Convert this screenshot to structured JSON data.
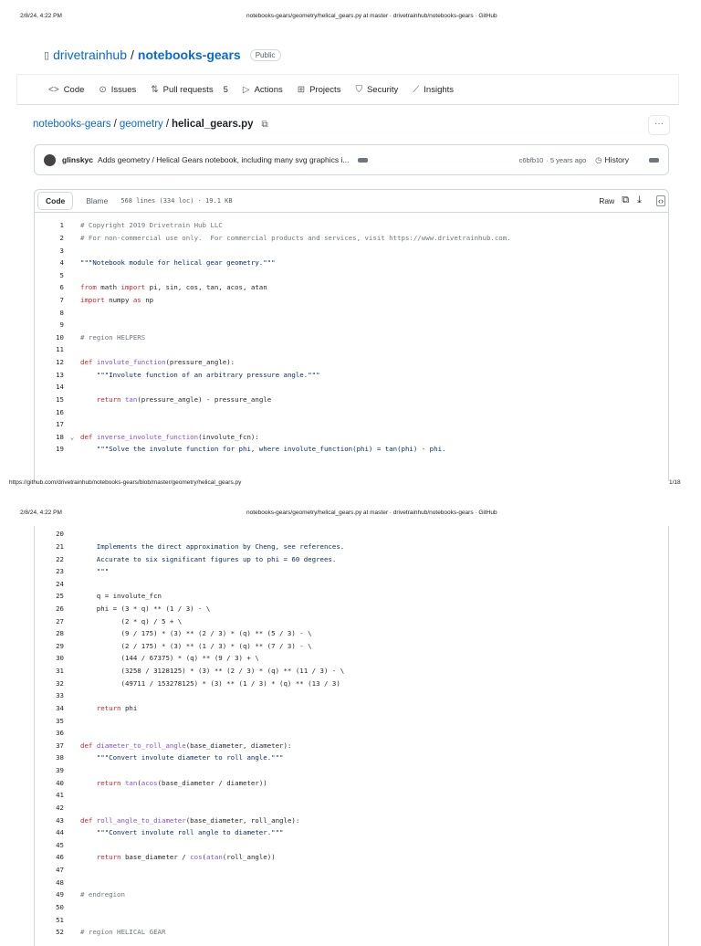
{
  "print_header": {
    "datetime": "2/8/24, 4:22 PM",
    "title": "notebooks-gears/geometry/helical_gears.py at master · drivetrainhub/notebooks-gears · GitHub"
  },
  "print_footer": {
    "url": "https://github.com/drivetrainhub/notebooks-gears/blob/master/geometry/helical_gears.py",
    "page": "1/18"
  },
  "repo": {
    "owner": "drivetrainhub",
    "separator": "/",
    "name": "notebooks-gears",
    "visibility": "Public"
  },
  "nav": [
    {
      "label": "Code",
      "icon": "code-icon",
      "glyph": "<>"
    },
    {
      "label": "Issues",
      "icon": "issue-icon",
      "glyph": "⊙"
    },
    {
      "label": "Pull requests",
      "icon": "pull-request-icon",
      "glyph": "⇅",
      "count": "5"
    },
    {
      "label": "Actions",
      "icon": "play-icon",
      "glyph": "▷"
    },
    {
      "label": "Projects",
      "icon": "table-icon",
      "glyph": "⊞"
    },
    {
      "label": "Security",
      "icon": "shield-icon",
      "glyph": "⛉"
    },
    {
      "label": "Insights",
      "icon": "graph-icon",
      "glyph": "⟋"
    }
  ],
  "breadcrumb": {
    "repo": "notebooks-gears",
    "folder": "geometry",
    "file": "helical_gears.py",
    "sep": "/"
  },
  "commit": {
    "author": "glinskyc",
    "message": "Adds geometry / Helical Gears notebook, including many svg graphics i...",
    "sha": "c6bfb10",
    "age": "· 5 years ago",
    "history": "History"
  },
  "file": {
    "tab_code": "Code",
    "tab_blame": "Blame",
    "info": "568 lines (334 loc) · 19.1 KB",
    "raw": "Raw"
  },
  "code_pages": [
    {
      "start": 1,
      "lines": [
        [
          [
            "c",
            "# Copyright 2019 Drivetrain Hub LLC"
          ]
        ],
        [
          [
            "c",
            "# For non-commercial use only.  For commercial products and services, visit https://www.drivetrainhub.com."
          ]
        ],
        [],
        [
          [
            "s",
            "\"\"\"Notebook module for helical gear geometry.\"\"\""
          ]
        ],
        [],
        [
          [
            "k",
            "from"
          ],
          [
            "n",
            " math "
          ],
          [
            "k",
            "import"
          ],
          [
            "n",
            " pi, sin, cos, tan, acos, atan"
          ]
        ],
        [
          [
            "k",
            "import"
          ],
          [
            "n",
            " numpy "
          ],
          [
            "k",
            "as"
          ],
          [
            "n",
            " np"
          ]
        ],
        [],
        [],
        [
          [
            "c",
            "# region HELPERS"
          ]
        ],
        [],
        [
          [
            "k",
            "def"
          ],
          [
            "n",
            " "
          ],
          [
            "f",
            "involute_function"
          ],
          [
            "n",
            "(pressure_angle):"
          ]
        ],
        [
          [
            "n",
            "    "
          ],
          [
            "s",
            "\"\"\"Involute function of an arbitrary pressure angle.\"\"\""
          ]
        ],
        [],
        [
          [
            "n",
            "    "
          ],
          [
            "k",
            "return"
          ],
          [
            "n",
            " "
          ],
          [
            "f",
            "tan"
          ],
          [
            "n",
            "(pressure_angle) - pressure_angle"
          ]
        ],
        [],
        [],
        [
          [
            "k",
            "def"
          ],
          [
            "n",
            " "
          ],
          [
            "f",
            "inverse_involute_function"
          ],
          [
            "n",
            "(involute_fcn):"
          ]
        ],
        [
          [
            "n",
            "    "
          ],
          [
            "s",
            "\"\"\"Solve the involute function for phi, where involute_function(phi) = tan(phi) - phi."
          ]
        ]
      ]
    },
    {
      "start": 20,
      "lines": [
        [],
        [
          [
            "s",
            "    Implements the direct approximation by Cheng, see references."
          ]
        ],
        [
          [
            "s",
            "    Accurate to six significant figures up to phi = 60 degrees."
          ]
        ],
        [
          [
            "s",
            "    \"\"\""
          ]
        ],
        [],
        [
          [
            "n",
            "    q = involute_fcn"
          ]
        ],
        [
          [
            "n",
            "    phi = (3 * q) ** (1 / 3) - \\"
          ]
        ],
        [
          [
            "n",
            "          (2 * q) / 5 + \\"
          ]
        ],
        [
          [
            "n",
            "          (9 / 175) * (3) ** (2 / 3) * (q) ** (5 / 3) - \\"
          ]
        ],
        [
          [
            "n",
            "          (2 / 175) * (3) ** (1 / 3) * (q) ** (7 / 3) - \\"
          ]
        ],
        [
          [
            "n",
            "          (144 / 67375) * (q) ** (9 / 3) + \\"
          ]
        ],
        [
          [
            "n",
            "          (3258 / 3128125) * (3) ** (2 / 3) * (q) ** (11 / 3) - \\"
          ]
        ],
        [
          [
            "n",
            "          (49711 / 153278125) * (3) ** (1 / 3) * (q) ** (13 / 3)"
          ]
        ],
        [],
        [
          [
            "n",
            "    "
          ],
          [
            "k",
            "return"
          ],
          [
            "n",
            " phi"
          ]
        ],
        [],
        [],
        [
          [
            "k",
            "def"
          ],
          [
            "n",
            " "
          ],
          [
            "f",
            "diameter_to_roll_angle"
          ],
          [
            "n",
            "(base_diameter, diameter):"
          ]
        ],
        [
          [
            "n",
            "    "
          ],
          [
            "s",
            "\"\"\"Convert involute diameter to roll angle.\"\"\""
          ]
        ],
        [],
        [
          [
            "n",
            "    "
          ],
          [
            "k",
            "return"
          ],
          [
            "n",
            " "
          ],
          [
            "f",
            "tan"
          ],
          [
            "n",
            "("
          ],
          [
            "f",
            "acos"
          ],
          [
            "n",
            "(base_diameter / diameter))"
          ]
        ],
        [],
        [],
        [
          [
            "k",
            "def"
          ],
          [
            "n",
            " "
          ],
          [
            "f",
            "roll_angle_to_diameter"
          ],
          [
            "n",
            "(base_diameter, roll_angle):"
          ]
        ],
        [
          [
            "n",
            "    "
          ],
          [
            "s",
            "\"\"\"Convert involute roll angle to diameter.\"\"\""
          ]
        ],
        [],
        [
          [
            "n",
            "    "
          ],
          [
            "k",
            "return"
          ],
          [
            "n",
            " base_diameter / "
          ],
          [
            "f",
            "cos"
          ],
          [
            "n",
            "("
          ],
          [
            "f",
            "atan"
          ],
          [
            "n",
            "(roll_angle))"
          ]
        ],
        [],
        [],
        [
          [
            "c",
            "# endregion"
          ]
        ],
        [],
        [],
        [
          [
            "c",
            "# region HELICAL GEAR"
          ]
        ]
      ]
    }
  ]
}
